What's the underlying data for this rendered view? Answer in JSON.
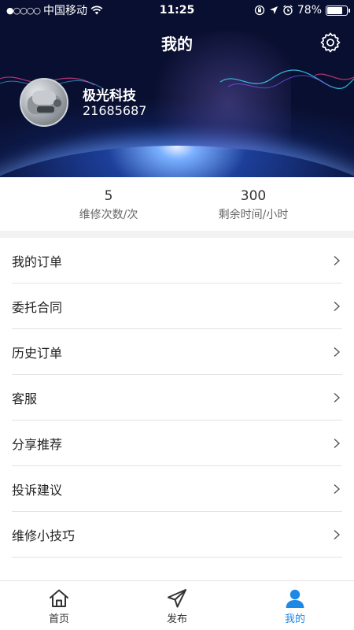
{
  "status_bar": {
    "signal": "●○○○○",
    "carrier": "中国移动",
    "time": "11:25",
    "battery_percent": "78%",
    "battery_level": 0.78
  },
  "header": {
    "title": "我的",
    "settings_icon": "gear-icon"
  },
  "profile": {
    "name": "极光科技",
    "id": "21685687"
  },
  "stats": [
    {
      "value": "5",
      "label": "维修次数/次"
    },
    {
      "value": "300",
      "label": "剩余时间/小时"
    }
  ],
  "menu": [
    {
      "label": "我的订单"
    },
    {
      "label": "委托合同"
    },
    {
      "label": "历史订单"
    },
    {
      "label": "客服"
    },
    {
      "label": "分享推荐"
    },
    {
      "label": "投诉建议"
    },
    {
      "label": "维修小技巧"
    }
  ],
  "tabbar": {
    "items": [
      {
        "label": "首页",
        "icon": "home-icon"
      },
      {
        "label": "发布",
        "icon": "send-icon"
      },
      {
        "label": "我的",
        "icon": "user-icon"
      }
    ],
    "active_color": "#1e88e5"
  }
}
